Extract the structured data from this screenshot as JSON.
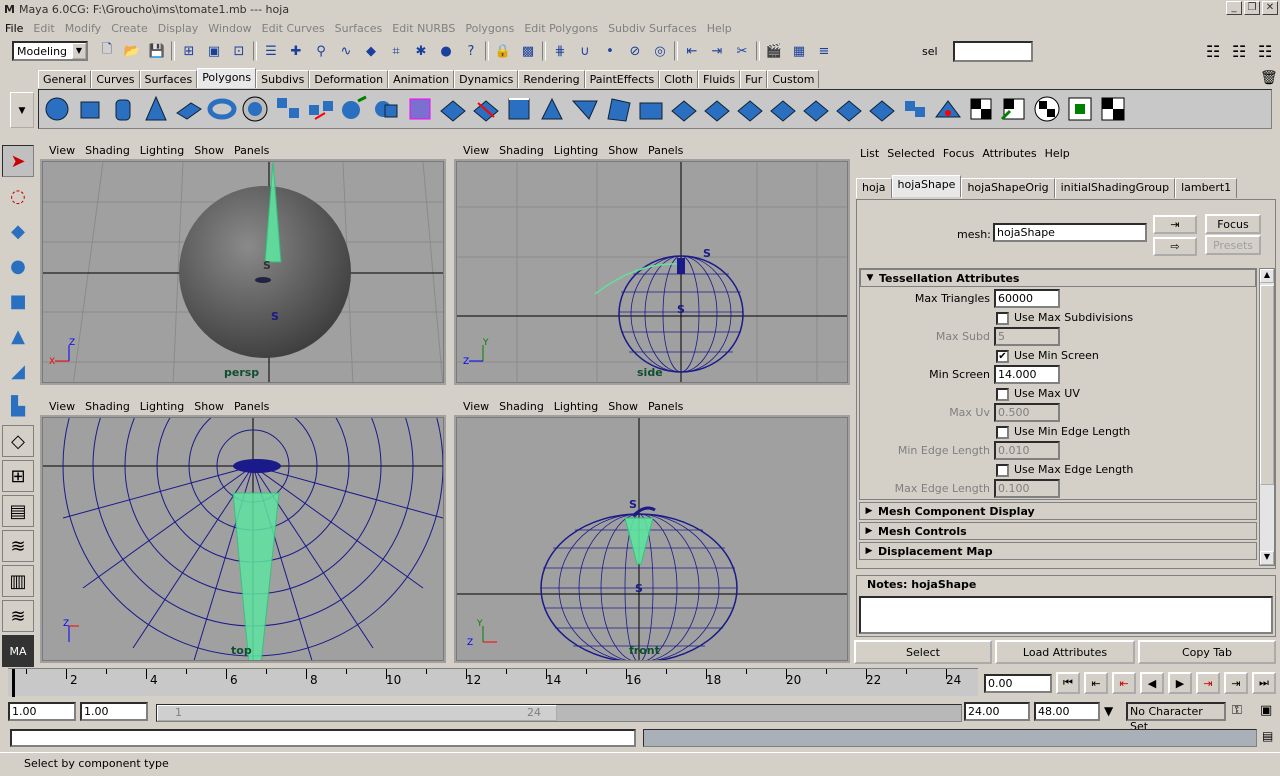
{
  "window": {
    "title": "Maya 6.0CG: F:\\Groucho\\ims\\tomate1.mb  ---  hoja",
    "min": "_",
    "max": "❐",
    "close": "✕"
  },
  "menubar": [
    "File",
    "Edit",
    "Modify",
    "Create",
    "Display",
    "Window",
    "Edit Curves",
    "Surfaces",
    "Edit NURBS",
    "Polygons",
    "Edit Polygons",
    "Subdiv Surfaces",
    "Help"
  ],
  "status": {
    "mode": "Modeling",
    "sel_label": "sel",
    "sel_value": ""
  },
  "shelf": {
    "tabs": [
      "General",
      "Curves",
      "Surfaces",
      "Polygons",
      "Subdivs",
      "Deformation",
      "Animation",
      "Dynamics",
      "Rendering",
      "PaintEffects",
      "Cloth",
      "Fluids",
      "Fur",
      "Custom"
    ],
    "active": "Polygons"
  },
  "viewports": {
    "menu": [
      "View",
      "Shading",
      "Lighting",
      "Show",
      "Panels"
    ],
    "persp": "persp",
    "side": "side",
    "top": "top",
    "front": "front",
    "s_marker": "S"
  },
  "attr_editor": {
    "menu": [
      "List",
      "Selected",
      "Focus",
      "Attributes",
      "Help"
    ],
    "tabs": [
      "hoja",
      "hojaShape",
      "hojaShapeOrig",
      "initialShadingGroup",
      "lambert1"
    ],
    "active_tab": "hojaShape",
    "mesh_label": "mesh:",
    "mesh_value": "hojaShape",
    "focus": "Focus",
    "presets": "Presets",
    "tess_title": "Tessellation Attributes",
    "max_triangles_label": "Max Triangles",
    "max_triangles": "60000",
    "use_max_subdiv": "Use Max Subdivisions",
    "max_subd_label": "Max Subd",
    "max_subd": "5",
    "use_min_screen": "Use Min Screen",
    "min_screen_label": "Min Screen",
    "min_screen": "14.000",
    "use_max_uv": "Use Max UV",
    "max_uv_label": "Max Uv",
    "max_uv": "0.500",
    "use_min_edge": "Use Min Edge Length",
    "min_edge_label": "Min Edge Length",
    "min_edge": "0.010",
    "use_max_edge": "Use Max Edge Length",
    "max_edge_label": "Max Edge Length",
    "max_edge": "0.100",
    "sections": [
      "Mesh Component Display",
      "Mesh Controls",
      "Displacement Map"
    ],
    "notes_label": "Notes: hojaShape",
    "select": "Select",
    "load_attributes": "Load Attributes",
    "copy_tab": "Copy Tab"
  },
  "timeline": {
    "ticks": [
      "2",
      "4",
      "6",
      "8",
      "10",
      "12",
      "14",
      "16",
      "18",
      "20",
      "22",
      "24"
    ],
    "current": "0.00"
  },
  "range": {
    "start": "1.00",
    "start2": "1.00",
    "bar_start": "1",
    "bar_end": "24",
    "end": "24.00",
    "end2": "48.00",
    "character": "No Character Set"
  },
  "helpline": "Select by component type"
}
